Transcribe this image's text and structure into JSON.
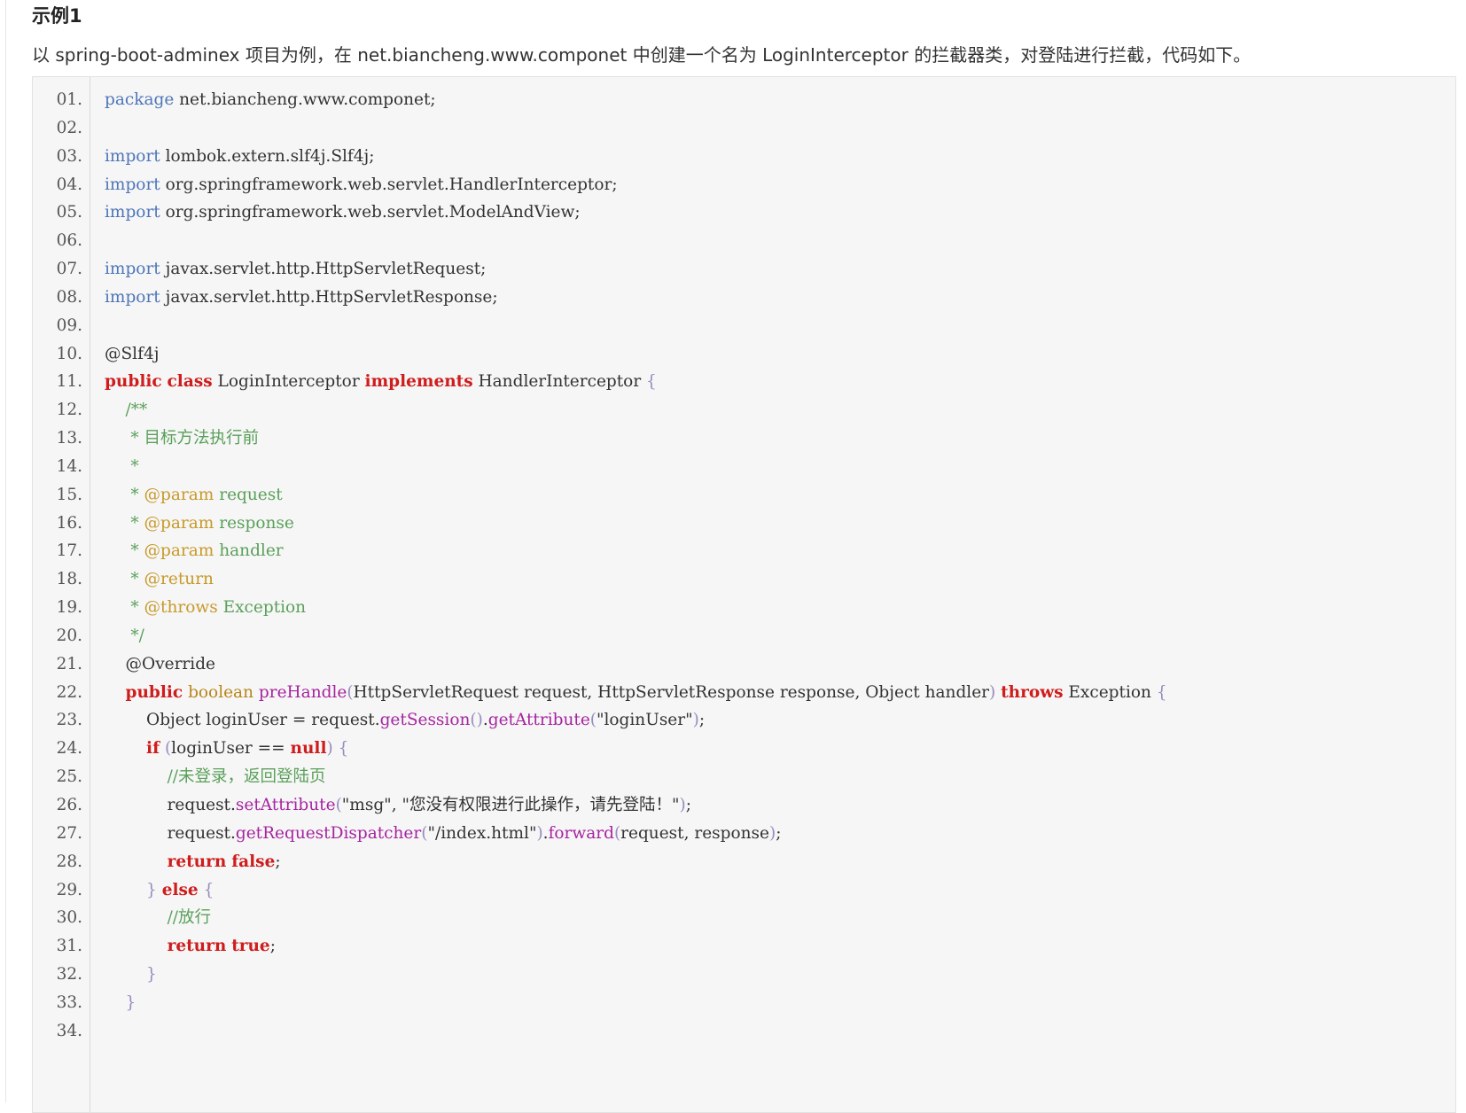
{
  "header": {
    "example_title": "示例1",
    "intro": "以 spring-boot-adminex 项目为例，在 net.biancheng.www.componet 中创建一个名为 LoginInterceptor 的拦截器类，对登陆进行拦截，代码如下。"
  },
  "code": {
    "lines": [
      {
        "n": "01.",
        "t": "package net.biancheng.www.componet;"
      },
      {
        "n": "02.",
        "t": ""
      },
      {
        "n": "03.",
        "t": "import lombok.extern.slf4j.Slf4j;"
      },
      {
        "n": "04.",
        "t": "import org.springframework.web.servlet.HandlerInterceptor;"
      },
      {
        "n": "05.",
        "t": "import org.springframework.web.servlet.ModelAndView;"
      },
      {
        "n": "06.",
        "t": ""
      },
      {
        "n": "07.",
        "t": "import javax.servlet.http.HttpServletRequest;"
      },
      {
        "n": "08.",
        "t": "import javax.servlet.http.HttpServletResponse;"
      },
      {
        "n": "09.",
        "t": ""
      },
      {
        "n": "10.",
        "t": "@Slf4j"
      },
      {
        "n": "11.",
        "t": "public class LoginInterceptor implements HandlerInterceptor {"
      },
      {
        "n": "12.",
        "t": "    /**"
      },
      {
        "n": "13.",
        "t": "     * 目标方法执行前"
      },
      {
        "n": "14.",
        "t": "     *"
      },
      {
        "n": "15.",
        "t": "     * @param request"
      },
      {
        "n": "16.",
        "t": "     * @param response"
      },
      {
        "n": "17.",
        "t": "     * @param handler"
      },
      {
        "n": "18.",
        "t": "     * @return"
      },
      {
        "n": "19.",
        "t": "     * @throws Exception"
      },
      {
        "n": "20.",
        "t": "     */"
      },
      {
        "n": "21.",
        "t": "    @Override"
      },
      {
        "n": "22.",
        "t": "    public boolean preHandle(HttpServletRequest request, HttpServletResponse response, Object handler) throws Exception {"
      },
      {
        "n": "23.",
        "t": "        Object loginUser = request.getSession().getAttribute(\"loginUser\");"
      },
      {
        "n": "24.",
        "t": "        if (loginUser == null) {"
      },
      {
        "n": "25.",
        "t": "            //未登录，返回登陆页"
      },
      {
        "n": "26.",
        "t": "            request.setAttribute(\"msg\", \"您没有权限进行此操作，请先登陆！\");"
      },
      {
        "n": "27.",
        "t": "            request.getRequestDispatcher(\"/index.html\").forward(request, response);"
      },
      {
        "n": "28.",
        "t": "            return false;"
      },
      {
        "n": "29.",
        "t": "        } else {"
      },
      {
        "n": "30.",
        "t": "            //放行"
      },
      {
        "n": "31.",
        "t": "            return true;"
      },
      {
        "n": "32.",
        "t": "        }"
      },
      {
        "n": "33.",
        "t": "    }"
      },
      {
        "n": "34.",
        "t": ""
      }
    ]
  }
}
